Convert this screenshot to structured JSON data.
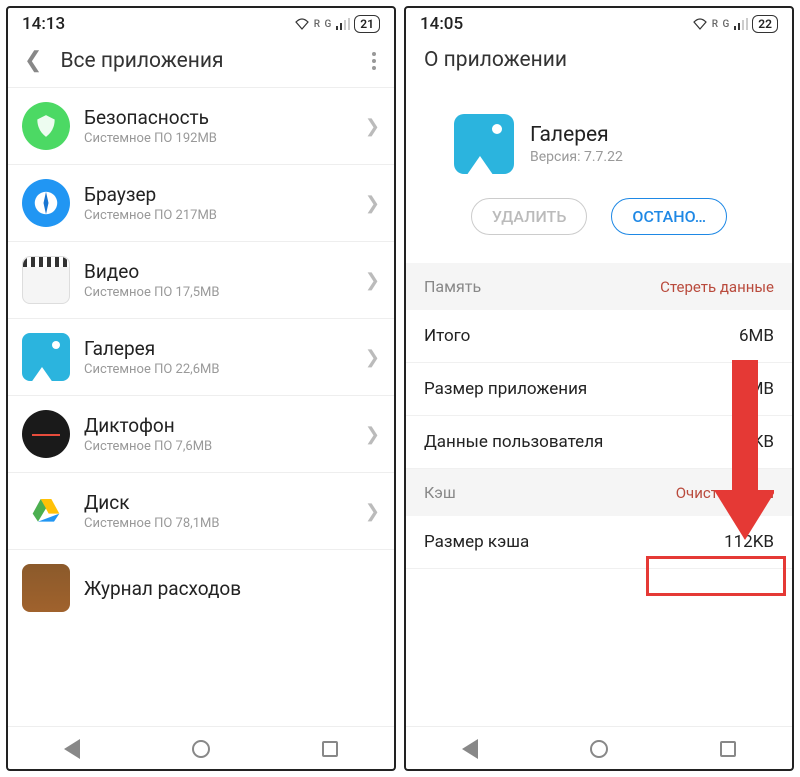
{
  "left": {
    "status": {
      "time": "14:13",
      "battery": "21",
      "net": "R   G"
    },
    "header": {
      "title": "Все приложения"
    },
    "apps": [
      {
        "name": "Безопасность",
        "sub": "Системное ПО   192MB"
      },
      {
        "name": "Браузер",
        "sub": "Системное ПО   217MB"
      },
      {
        "name": "Видео",
        "sub": "Системное ПО   17,5MB"
      },
      {
        "name": "Галерея",
        "sub": "Системное ПО   22,6MB"
      },
      {
        "name": "Диктофон",
        "sub": "Системное ПО   7,6MB"
      },
      {
        "name": "Диск",
        "sub": "Системное ПО   78,1MB"
      },
      {
        "name": "Журнал расходов",
        "sub": ""
      }
    ]
  },
  "right": {
    "status": {
      "time": "14:05",
      "battery": "22",
      "net": "R   G"
    },
    "header": {
      "title": "О приложении"
    },
    "app": {
      "name": "Галерея",
      "version": "Версия: 7.7.22"
    },
    "buttons": {
      "delete": "УДАЛИТЬ",
      "stop": "ОСТАНО…"
    },
    "memory": {
      "label": "Память",
      "action": "Стереть данные",
      "rows": [
        {
          "k": "Итого",
          "v": "6MB"
        },
        {
          "k": "Размер приложения",
          "v": "MB"
        },
        {
          "k": "Данные пользователя",
          "v": "96KB"
        }
      ]
    },
    "cache": {
      "label": "Кэш",
      "action": "Очистить кэш",
      "rows": [
        {
          "k": "Размер кэша",
          "v": "112KB"
        }
      ]
    }
  }
}
